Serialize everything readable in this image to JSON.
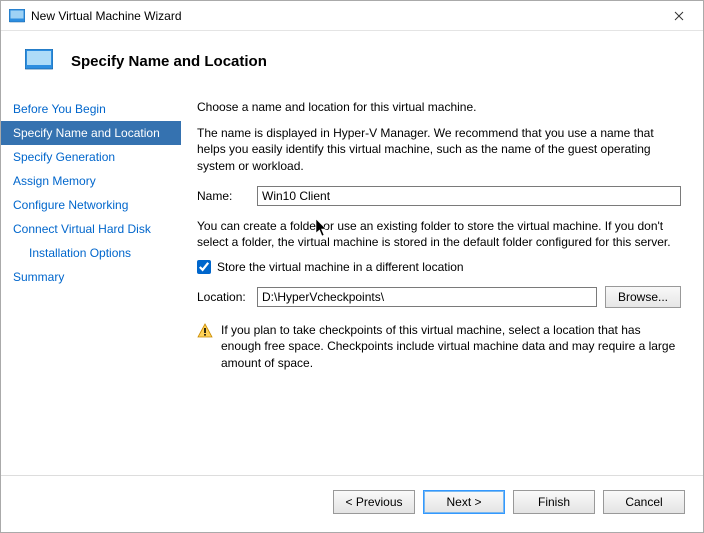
{
  "window": {
    "title": "New Virtual Machine Wizard"
  },
  "header": {
    "heading": "Specify Name and Location"
  },
  "sidebar": {
    "items": [
      {
        "label": "Before You Begin"
      },
      {
        "label": "Specify Name and Location"
      },
      {
        "label": "Specify Generation"
      },
      {
        "label": "Assign Memory"
      },
      {
        "label": "Configure Networking"
      },
      {
        "label": "Connect Virtual Hard Disk"
      },
      {
        "label": "Installation Options"
      },
      {
        "label": "Summary"
      }
    ]
  },
  "content": {
    "intro1": "Choose a name and location for this virtual machine.",
    "intro2": "The name is displayed in Hyper-V Manager. We recommend that you use a name that helps you easily identify this virtual machine, such as the name of the guest operating system or workload.",
    "name_label": "Name:",
    "name_value": "Win10 Client",
    "folder_text": "You can create a folder or use an existing folder to store the virtual machine. If you don't select a folder, the virtual machine is stored in the default folder configured for this server.",
    "checkbox_label": "Store the virtual machine in a different location",
    "location_label": "Location:",
    "location_value": "D:\\HyperVcheckpoints\\",
    "browse_label": "Browse...",
    "warning_text": "If you plan to take checkpoints of this virtual machine, select a location that has enough free space. Checkpoints include virtual machine data and may require a large amount of space."
  },
  "footer": {
    "previous": "< Previous",
    "next": "Next >",
    "finish": "Finish",
    "cancel": "Cancel"
  }
}
